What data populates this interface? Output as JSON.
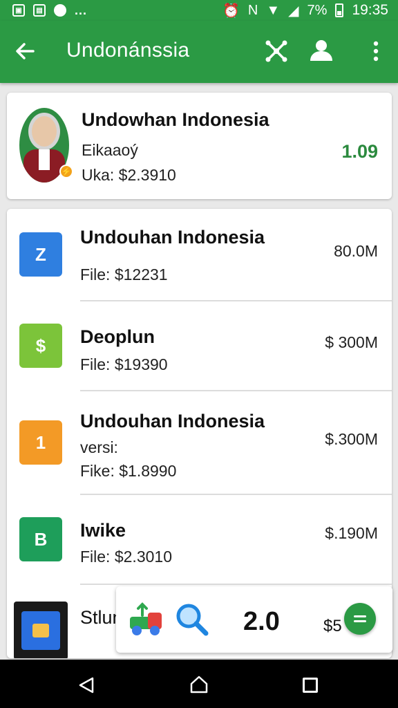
{
  "status_bar": {
    "left_icons": [
      "gallery-icon",
      "clipboard-icon",
      "location-icon"
    ],
    "overflow": "...",
    "icons": [
      "alarm-icon",
      "nfc-icon",
      "wifi-icon",
      "signal-icon",
      "battery-icon"
    ],
    "battery": "7%",
    "time": "19:35"
  },
  "app_bar": {
    "title": "Undonánssia",
    "icons": [
      "back-arrow-icon",
      "share-icon",
      "person-icon",
      "more-vert-icon"
    ]
  },
  "profile": {
    "name": "Undowhan Indonesia",
    "line1": "Eikaaoý",
    "line2": "Uka: $2.3910",
    "score": "1.09",
    "badge": "⚡"
  },
  "list": [
    {
      "icon": "zip-file-icon",
      "glyph": "Z",
      "color": "#2f7fe0",
      "title": "Undouhan Indonesia",
      "sub": "",
      "file": "File: $12231",
      "size": "80.0M"
    },
    {
      "icon": "money-file-icon",
      "glyph": "$",
      "color": "#7cc43a",
      "title": "Deoplun",
      "sub": "",
      "file": "File: $19390",
      "size": "$ 300M"
    },
    {
      "icon": "package-file-icon",
      "glyph": "1",
      "color": "#f39a26",
      "title": "Undouhan Indonesia",
      "sub": "versi:",
      "file": "Fike: $1.8990",
      "size": "$.300M"
    },
    {
      "icon": "sheet-file-icon",
      "glyph": "B",
      "color": "#1e9e5a",
      "title": "Iwike",
      "sub": "",
      "file": "File: $2.3010",
      "size": "$.190M"
    },
    {
      "icon": "photo-app-icon",
      "glyph": "",
      "color": "#1a1a1a",
      "title": "Stlun",
      "sub": "",
      "file": "",
      "size": ""
    }
  ],
  "bottom_bar": {
    "version": "2.0",
    "price": "$5",
    "icons": [
      "truck-app-icon",
      "search-icon",
      "menu-fab-icon"
    ]
  },
  "colors": {
    "primary": "#2b9a44",
    "score": "#2b8a3e"
  }
}
